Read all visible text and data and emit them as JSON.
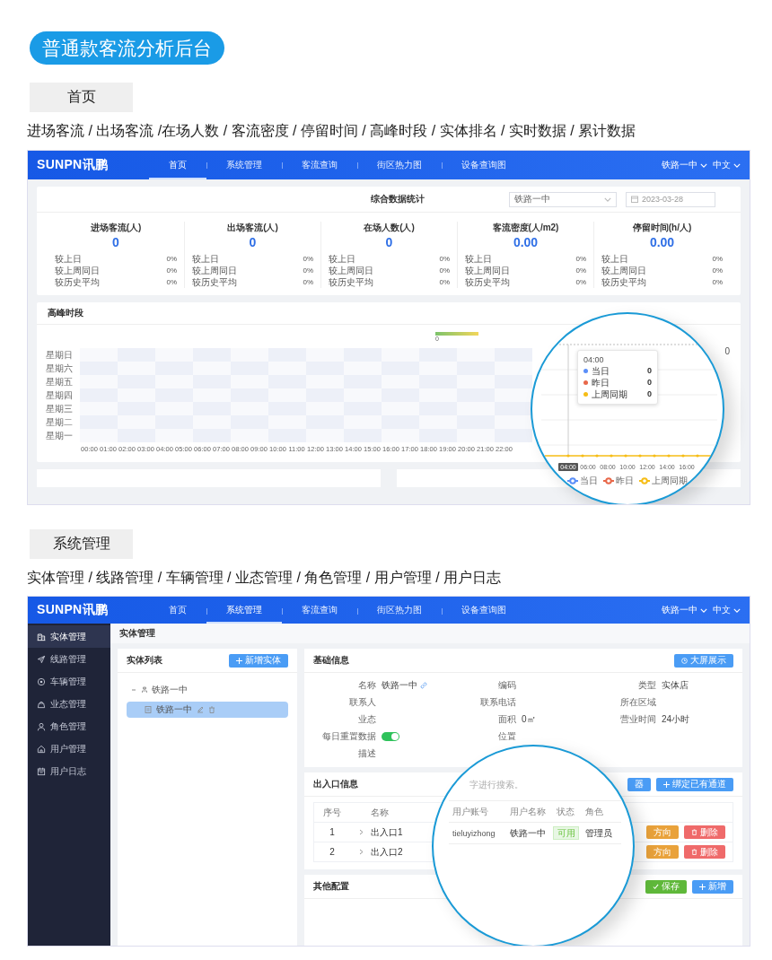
{
  "banner": {
    "title": "普通款客流分析后台"
  },
  "dashboard_section": {
    "tag": "首页",
    "features": "进场客流 / 出场客流 /在场人数 / 客流密度 / 停留时间 / 高峰时段 / 实体排名 / 实时数据 / 累计数据",
    "screen": {
      "logo": "SUNPN讯鹏",
      "nav": [
        {
          "label": "首页",
          "selected": true
        },
        {
          "label": "系统管理",
          "selected": false
        },
        {
          "label": "客流查询",
          "selected": false
        },
        {
          "label": "街区热力图",
          "selected": false
        },
        {
          "label": "设备查询图",
          "selected": false
        }
      ],
      "site_select": "铁路一中",
      "language": "中文",
      "stats_card": {
        "title": "综合数据统计",
        "entity_select": "铁路一中",
        "date": "2023-03-28",
        "metrics": [
          {
            "title": "进场客流(人)",
            "value": "0",
            "comparisons": [
              {
                "label": "较上日",
                "value": "0%"
              },
              {
                "label": "较上周同日",
                "value": "0%"
              },
              {
                "label": "较历史平均",
                "value": "0%"
              }
            ]
          },
          {
            "title": "出场客流(人)",
            "value": "0",
            "comparisons": [
              {
                "label": "较上日",
                "value": "0%"
              },
              {
                "label": "较上周同日",
                "value": "0%"
              },
              {
                "label": "较历史平均",
                "value": "0%"
              }
            ]
          },
          {
            "title": "在场人数(人)",
            "value": "0",
            "comparisons": [
              {
                "label": "较上日",
                "value": "0%"
              },
              {
                "label": "较上周同日",
                "value": "0%"
              },
              {
                "label": "较历史平均",
                "value": "0%"
              }
            ]
          },
          {
            "title": "客流密度(人/m2)",
            "value": "0.00",
            "comparisons": [
              {
                "label": "较上日",
                "value": "0%"
              },
              {
                "label": "较上周同日",
                "value": "0%"
              },
              {
                "label": "较历史平均",
                "value": "0%"
              }
            ]
          },
          {
            "title": "停留时间(h/人)",
            "value": "0.00",
            "comparisons": [
              {
                "label": "较上日",
                "value": "0%"
              },
              {
                "label": "较上周同日",
                "value": "0%"
              },
              {
                "label": "较历史平均",
                "value": "0%"
              }
            ]
          }
        ]
      },
      "peak_card": {
        "title": "高峰时段",
        "scale_label": "0",
        "side_value": "0",
        "y_labels": [
          "星期日",
          "星期六",
          "星期五",
          "星期四",
          "星期三",
          "星期二",
          "星期一"
        ],
        "x_labels": [
          "00:00",
          "01:00",
          "02:00",
          "03:00",
          "04:00",
          "05:00",
          "06:00",
          "07:00",
          "08:00",
          "09:00",
          "10:00",
          "11:00",
          "12:00",
          "13:00",
          "14:00",
          "15:00",
          "16:00",
          "17:00",
          "18:00",
          "19:00",
          "20:00",
          "21:00",
          "22:00"
        ]
      },
      "lens": {
        "tooltip": {
          "time": "04:00",
          "items": [
            {
              "name": "当日",
              "value": "0",
              "color": "#5b8ff9"
            },
            {
              "name": "昨日",
              "value": "0",
              "color": "#e8684a"
            },
            {
              "name": "上周同期",
              "value": "0",
              "color": "#f6bd16"
            }
          ]
        },
        "x_labels": [
          {
            "label": "04:00",
            "selected": true
          },
          {
            "label": "06:00",
            "selected": false
          },
          {
            "label": "08:00",
            "selected": false
          },
          {
            "label": "10:00",
            "selected": false
          },
          {
            "label": "12:00",
            "selected": false
          },
          {
            "label": "14:00",
            "selected": false
          },
          {
            "label": "16:00",
            "selected": false
          }
        ],
        "legend": [
          {
            "name": "当日",
            "color": "#5b8ff9"
          },
          {
            "name": "昨日",
            "color": "#e8684a"
          },
          {
            "name": "上周同期",
            "color": "#f6bd16"
          }
        ]
      }
    }
  },
  "admin_section": {
    "tag": "系统管理",
    "features": "实体管理 / 线路管理 / 车辆管理 / 业态管理 / 角色管理 / 用户管理 / 用户日志",
    "screen": {
      "logo": "SUNPN讯鹏",
      "nav": [
        {
          "label": "首页",
          "selected": false
        },
        {
          "label": "系统管理",
          "selected": true
        },
        {
          "label": "客流查询",
          "selected": false
        },
        {
          "label": "街区热力图",
          "selected": false
        },
        {
          "label": "设备查询图",
          "selected": false
        }
      ],
      "site_select": "铁路一中",
      "language": "中文",
      "sidebar": [
        {
          "label": "实体管理",
          "selected": true
        },
        {
          "label": "线路管理",
          "selected": false
        },
        {
          "label": "车辆管理",
          "selected": false
        },
        {
          "label": "业态管理",
          "selected": false
        },
        {
          "label": "角色管理",
          "selected": false
        },
        {
          "label": "用户管理",
          "selected": false
        },
        {
          "label": "用户日志",
          "selected": false
        }
      ],
      "page_title": "实体管理",
      "entity_list": {
        "title": "实体列表",
        "add_button": "新增实体",
        "tree": [
          {
            "label": "铁路一中",
            "expanded": true,
            "children": [
              {
                "label": "铁路一中",
                "selected": true
              }
            ]
          }
        ]
      },
      "basic_info": {
        "title": "基础信息",
        "action_button": "大屏展示",
        "field_rows": [
          [
            {
              "label": "名称",
              "value": "铁路一中",
              "kind": "link"
            },
            {
              "label": "编码",
              "kind": "text"
            },
            {
              "label": "类型",
              "value": "实体店",
              "kind": "text"
            }
          ],
          [
            {
              "label": "联系人",
              "kind": "text"
            },
            {
              "label": "联系电话",
              "kind": "text"
            },
            {
              "label": "所在区域",
              "kind": "text"
            }
          ],
          [
            {
              "label": "业态",
              "kind": "text"
            },
            {
              "label": "面积",
              "value": "0㎡",
              "kind": "text"
            },
            {
              "label": "营业时间",
              "value": "24小时",
              "kind": "text"
            }
          ],
          [
            {
              "label": "每日重置数据",
              "kind": "toggle",
              "on": true
            },
            {
              "label": "位置",
              "kind": "text"
            }
          ],
          [
            {
              "label": "描述",
              "kind": "text"
            }
          ]
        ]
      },
      "exits": {
        "title": "出入口信息",
        "buttons": [
          {
            "label": "器",
            "kind": "plain"
          },
          {
            "label": "绑定已有通道",
            "kind": "add"
          }
        ],
        "columns": [
          "序号",
          "名称"
        ],
        "rows": [
          {
            "index": "1",
            "name": "出入口1",
            "action": "方向",
            "delete": "删除"
          },
          {
            "index": "2",
            "name": "出入口2",
            "action": "方向",
            "delete": "删除"
          }
        ]
      },
      "other_config": {
        "title": "其他配置",
        "buttons": [
          {
            "label": "保存",
            "kind": "save"
          },
          {
            "label": "新增",
            "kind": "add"
          }
        ]
      },
      "lens": {
        "hint": "字进行搜索。",
        "columns": [
          "用户账号",
          "用户名称",
          "状态",
          "角色"
        ],
        "rows": [
          {
            "account": "tieluyizhong",
            "name": "铁路一中",
            "status": "可用",
            "role": "管理员"
          }
        ]
      }
    }
  }
}
